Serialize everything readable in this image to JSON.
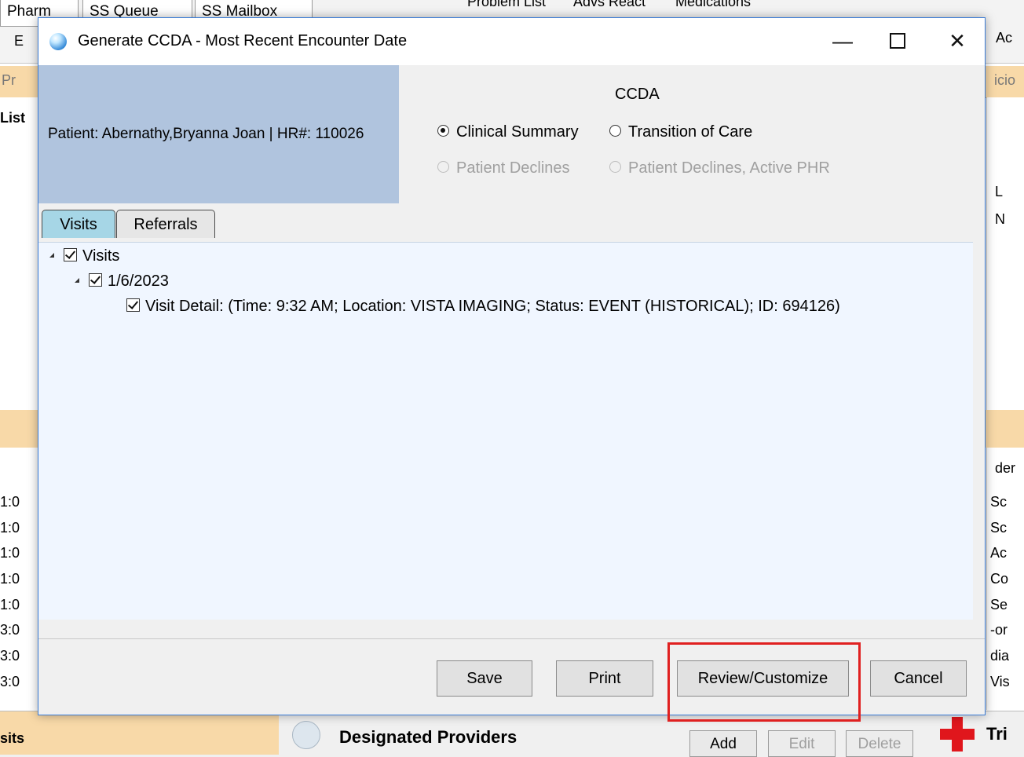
{
  "background": {
    "top_tabs": [
      "Pharm",
      "SS Queue",
      "SS Mailbox",
      "Problem List",
      "Advs React",
      "Medications"
    ],
    "top_right_fragment": "Ac",
    "left_fragments": [
      "E",
      "Pr",
      "List",
      "1:0",
      "1:0",
      "1:0",
      "1:0",
      "1:0",
      "3:0",
      "3:0",
      "3:0"
    ],
    "right_fragments": [
      "icio",
      "L",
      "N",
      "Sc",
      "Sc",
      "Ac",
      "Co",
      "Se",
      "-or",
      "dia",
      "Vis",
      "der"
    ],
    "bottom_left_label": "sits",
    "designated_providers_label": "Designated Providers",
    "bottom_buttons": {
      "add": "Add",
      "edit": "Edit",
      "delete": "Delete"
    },
    "bottom_right_fragment": "Tri"
  },
  "dialog": {
    "title": "Generate CCDA - Most Recent Encounter Date",
    "window_buttons": {
      "minimize": "—",
      "close": "✕"
    },
    "patient_text": "Patient: Abernathy,Bryanna Joan | HR#: 110026",
    "ccda_label": "CCDA",
    "radios": {
      "clinical_summary": "Clinical Summary",
      "transition_of_care": "Transition of Care",
      "patient_declines": "Patient Declines",
      "patient_declines_active_phr": "Patient Declines, Active PHR"
    },
    "selected_radio": "clinical_summary",
    "tabs": {
      "visits": "Visits",
      "referrals": "Referrals"
    },
    "active_tab": "visits",
    "tree": {
      "root": "Visits",
      "date": "1/6/2023",
      "detail": "Visit Detail: (Time: 9:32 AM; Location: VISTA IMAGING; Status: EVENT (HISTORICAL); ID: 694126)"
    },
    "buttons": {
      "save": "Save",
      "print": "Print",
      "review_customize": "Review/Customize",
      "cancel": "Cancel"
    },
    "highlight_color": "#e02020"
  }
}
